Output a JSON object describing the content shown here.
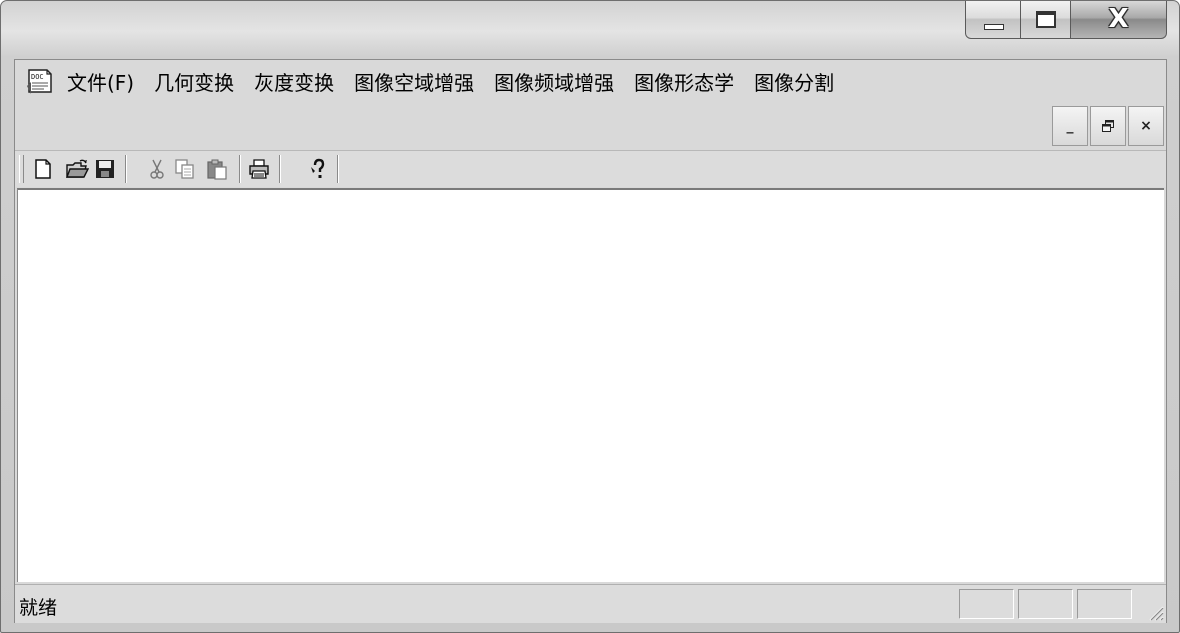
{
  "menu": {
    "items": [
      "文件(F)",
      "几何变换",
      "灰度变换",
      "图像空域增强",
      "图像频域增强",
      "图像形态学",
      "图像分割"
    ]
  },
  "window_controls": {
    "minimize": "minimize-icon",
    "maximize": "maximize-icon",
    "close": "close-icon",
    "close_glyph": "X"
  },
  "mdi_controls": {
    "minimize_glyph": "_",
    "restore_glyph": "🗗",
    "close_glyph": "×"
  },
  "toolbar": {
    "buttons": [
      "new-icon",
      "open-icon",
      "save-icon",
      "cut-icon",
      "copy-icon",
      "paste-icon",
      "print-icon",
      "help-icon"
    ]
  },
  "status": {
    "text": "就绪"
  }
}
